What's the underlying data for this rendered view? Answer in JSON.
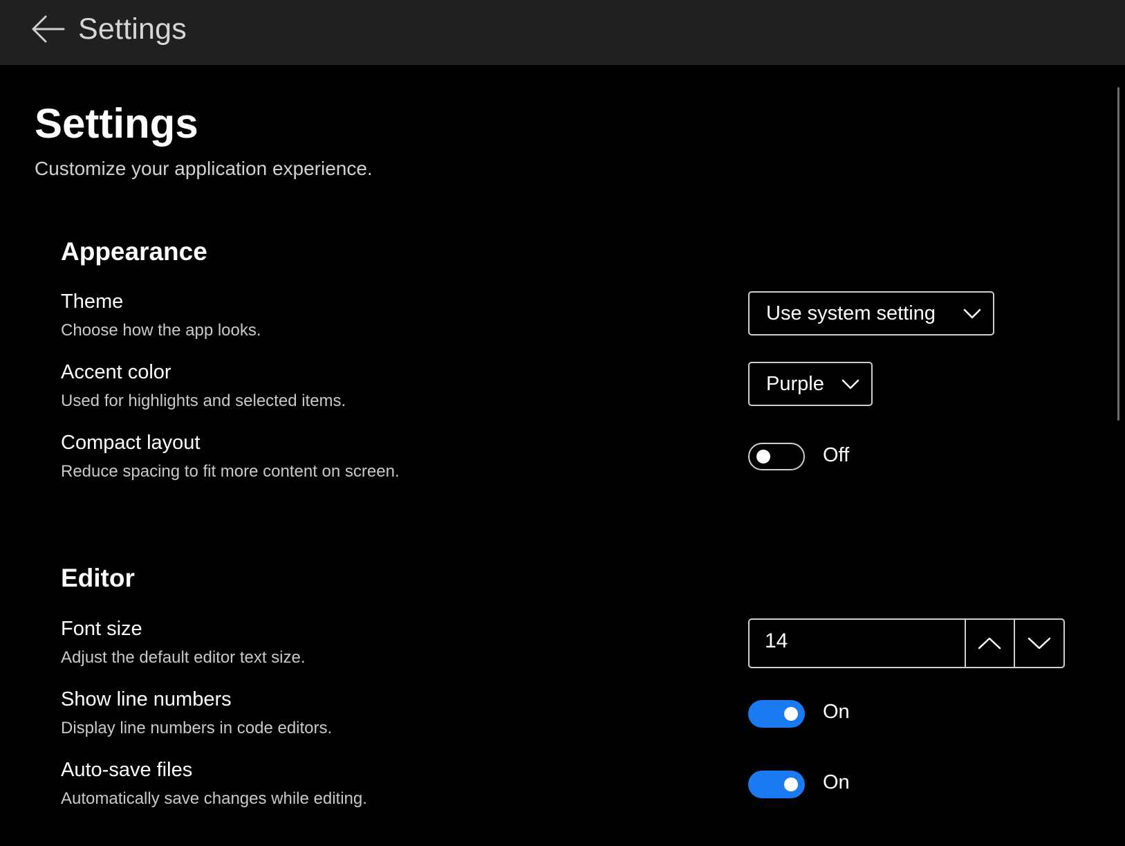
{
  "titlebar": {
    "back_icon": "arrow-left-icon",
    "title": "Settings"
  },
  "page": {
    "title": "Settings",
    "subtitle": "Customize your application experience."
  },
  "sections": {
    "appearance": {
      "title": "Appearance",
      "theme": {
        "label": "Theme",
        "description": "Choose how the app looks.",
        "value": "Use system setting"
      },
      "accent": {
        "label": "Accent color",
        "description": "Used for highlights and selected items.",
        "value": "Purple"
      },
      "compact": {
        "label": "Compact layout",
        "description": "Reduce spacing to fit more content on screen.",
        "state": "Off",
        "checked": false
      }
    },
    "editor": {
      "title": "Editor",
      "font_size": {
        "label": "Font size",
        "description": "Adjust the default editor text size.",
        "value": "14"
      },
      "line_numbers": {
        "label": "Show line numbers",
        "description": "Display line numbers in code editors.",
        "state": "On",
        "checked": true
      },
      "autosave": {
        "label": "Auto-save files",
        "description": "Automatically save changes while editing.",
        "state": "On",
        "checked": true
      }
    }
  },
  "colors": {
    "titlebar_bg": "#202020",
    "page_bg": "#000000",
    "toggle_on": "#1a7af2"
  }
}
